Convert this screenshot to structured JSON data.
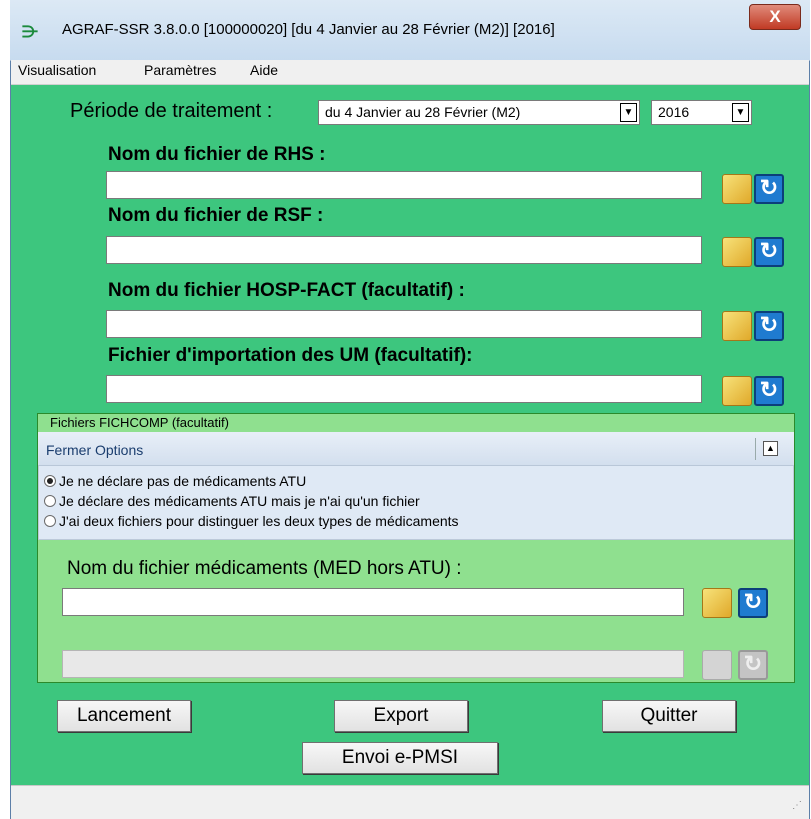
{
  "window": {
    "title": "AGRAF-SSR 3.8.0.0  [100000020]  [du 4 Janvier au 28 Février (M2)]  [2016]",
    "app_icon": "agraf-logo-icon",
    "close_label": "X"
  },
  "menu": {
    "items": [
      "Visualisation",
      "Paramètres",
      "Aide"
    ]
  },
  "periode": {
    "label": "Période de traitement :",
    "selected": "du 4 Janvier au 28 Février (M2)",
    "year": "2016"
  },
  "files": {
    "rhs_label": "Nom du fichier de RHS :",
    "rsf_label": "Nom du fichier de RSF :",
    "hosp_label": "Nom du fichier HOSP-FACT (facultatif) :",
    "um_label": "Fichier d'importation des UM (facultatif):",
    "rhs_value": "",
    "rsf_value": "",
    "hosp_value": "",
    "um_value": ""
  },
  "fichcomp": {
    "group_title": "Fichiers FICHCOMP (facultatif)",
    "options_title": "Fermer Options",
    "radios": [
      {
        "label": "Je ne déclare pas de médicaments ATU",
        "checked": true
      },
      {
        "label": "Je déclare des médicaments ATU mais je n'ai qu'un fichier",
        "checked": false
      },
      {
        "label": "J'ai deux fichiers pour distinguer les deux types de médicaments",
        "checked": false
      }
    ],
    "med_label": "Nom du fichier médicaments (MED hors ATU) :",
    "med_value": "",
    "med2_value": ""
  },
  "buttons": {
    "lancement": "Lancement",
    "export": "Export",
    "quitter": "Quitter",
    "envoi": "Envoi e-PMSI"
  },
  "colors": {
    "client_bg": "#3dc67e",
    "group_bg": "#8fe08f",
    "refresh_blue": "#1f7bd0"
  }
}
